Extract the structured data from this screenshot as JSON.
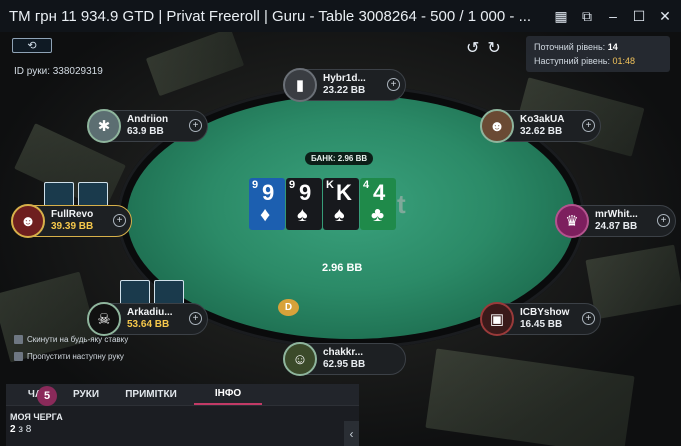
{
  "window": {
    "title": "TM грн 11 934.9 GTD | Privat Freeroll | Guru - Table 3008264 - 500 / 1 000 - ...",
    "controls": [
      "grid-icon",
      "popout-icon",
      "minimize-icon",
      "maximize-icon",
      "close-icon"
    ]
  },
  "hand": {
    "id_label": "ID руки: 338029319"
  },
  "level": {
    "current_label": "Поточний рівень:",
    "current_value": "14",
    "next_label": "Наступний рівень:",
    "next_value": "01:48"
  },
  "table": {
    "pot_label": "БАНК: 2.96 BB",
    "pot_amount": "2.96 BB",
    "board": [
      {
        "rank": "9",
        "suit": "♦",
        "color": "blue"
      },
      {
        "rank": "9",
        "suit": "♠",
        "color": "black"
      },
      {
        "rank": "K",
        "suit": "♠",
        "color": "black"
      },
      {
        "rank": "4",
        "suit": "♣",
        "color": "green"
      }
    ],
    "dealer_button": "D"
  },
  "players": [
    {
      "name": "Hybr1d...",
      "stack": "23.22 BB"
    },
    {
      "name": "Andriion",
      "stack": "63.9 BB"
    },
    {
      "name": "Ko3akUA",
      "stack": "32.62 BB"
    },
    {
      "name": "FullRevo",
      "stack": "39.39 BB"
    },
    {
      "name": "mrWhit...",
      "stack": "24.87 BB"
    },
    {
      "name": "Arkadiu...",
      "stack": "53.64 BB"
    },
    {
      "name": "ICBYshow",
      "stack": "16.45 BB"
    },
    {
      "name": "chakkr...",
      "stack": "62.95 BB"
    }
  ],
  "options": {
    "fold_any": "Скинути на будь-яку ставку",
    "sit_out": "Пропустити наступну руку"
  },
  "panel": {
    "tabs": [
      "ЧА",
      "РУКИ",
      "ПРИМІТКИ",
      "ІНФО"
    ],
    "badge": "5",
    "queue_title": "МОЯ ЧЕРГА",
    "queue_pos": "2",
    "queue_rest": " з 8"
  }
}
